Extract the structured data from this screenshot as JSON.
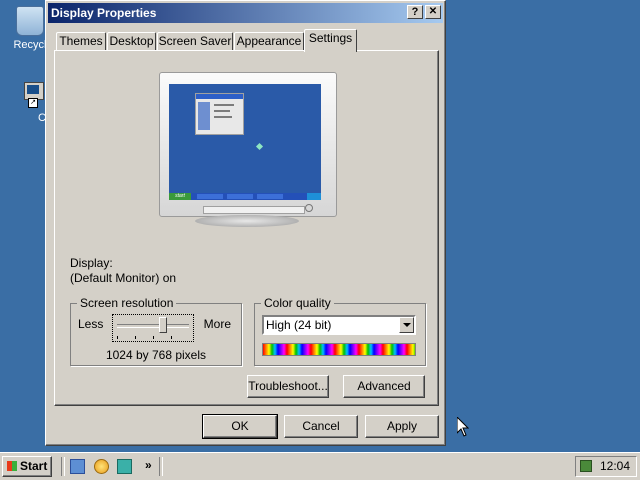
{
  "desktop": {
    "icons": [
      {
        "label": "Recycl",
        "icon": "recycle-bin-icon"
      },
      {
        "label": "C",
        "icon": "computer-icon"
      }
    ]
  },
  "window": {
    "title": "Display Properties",
    "help_label": "?",
    "close_label": "✕",
    "tabs": [
      {
        "label": "Themes"
      },
      {
        "label": "Desktop"
      },
      {
        "label": "Screen Saver"
      },
      {
        "label": "Appearance"
      },
      {
        "label": "Settings",
        "active": true
      }
    ],
    "display_label": "Display:",
    "display_value": "(Default Monitor) on",
    "screen_resolution": {
      "label": "Screen resolution",
      "less": "Less",
      "more": "More",
      "value": "1024 by 768 pixels",
      "slider_level": 0.75
    },
    "color_quality": {
      "label": "Color quality",
      "selected": "High (24 bit)"
    },
    "troubleshoot_label": "Troubleshoot...",
    "advanced_label": "Advanced",
    "ok_label": "OK",
    "cancel_label": "Cancel",
    "apply_label": "Apply"
  },
  "preview": {
    "start_label": "start"
  },
  "taskbar": {
    "start_label": "Start",
    "chevron": "»",
    "clock": "12:04"
  },
  "colors": {
    "desktop": "#3a6ea5",
    "title_start": "#0a246a",
    "title_end": "#a6caf0",
    "face": "#d4d0c8"
  }
}
